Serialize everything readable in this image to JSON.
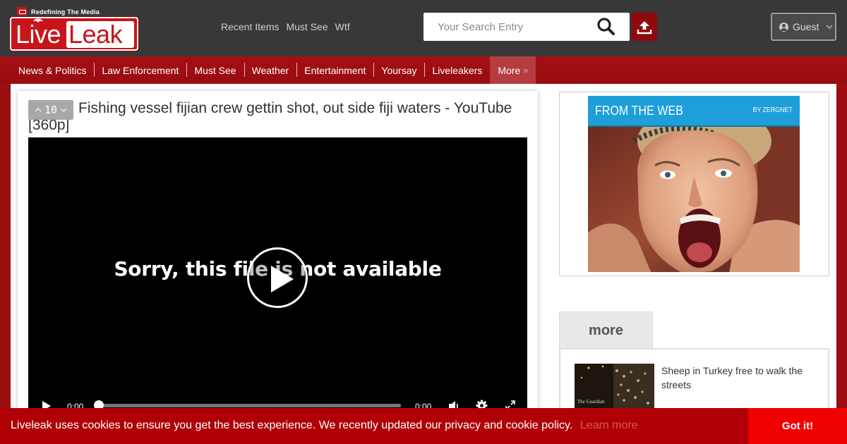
{
  "header": {
    "logo": {
      "tagline": "Redefining The Media",
      "word1": "Live",
      "word2": "Leak"
    },
    "links": [
      "Recent Items",
      "Must See",
      "Wtf"
    ],
    "search": {
      "placeholder": "Your Search Entry",
      "icon": "search-icon"
    },
    "upload_icon": "upload-icon",
    "account": {
      "label": "Guest",
      "icon": "user-icon",
      "caret": "chevron-down-icon"
    }
  },
  "nav": {
    "items": [
      "News & Politics",
      "Law Enforcement",
      "Must See",
      "Weather",
      "Entertainment",
      "Yoursay",
      "Liveleakers"
    ],
    "more_label": "More"
  },
  "video": {
    "vote_count": "10",
    "title": "Fishing vessel fijian crew gettin shot, out side fiji waters - YouTube [360p]",
    "error_message": "Sorry, this file is not available",
    "current_time": "0:00",
    "duration": "0:00",
    "progress": 0
  },
  "sidebar": {
    "ad": {
      "header": "FROM THE WEB",
      "byline": "BY ZERGNET"
    },
    "more_tab_label": "more",
    "more_items": [
      {
        "title": "Sheep in Turkey free to walk the streets",
        "thumb_caption": "The Guardian"
      }
    ]
  },
  "cookie": {
    "message": "Liveleak uses cookies to ensure you get the best experience. We recently updated our privacy and cookie policy.",
    "learn_more": "Learn more",
    "button": "Got it!"
  },
  "colors": {
    "header_bg": "#383838",
    "brand_red": "#c8151b",
    "nav_red": "#a40f13",
    "ad_blue": "#1e9fd9",
    "cookie_bg": "#b00006",
    "cookie_button": "#f00000"
  }
}
